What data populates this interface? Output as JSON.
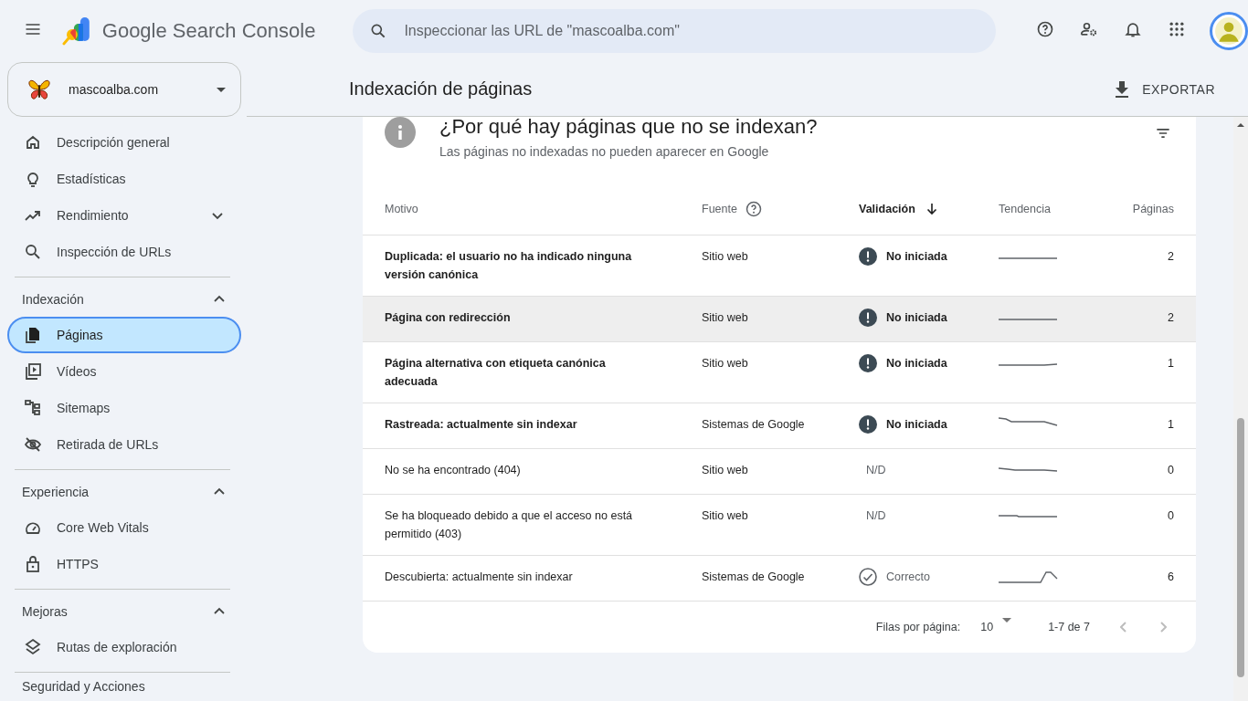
{
  "header": {
    "product_name": "Google Search Console",
    "search": {
      "placeholder": "Inspeccionar las URL de \"mascoalba.com\""
    }
  },
  "property": {
    "name": "mascoalba.com"
  },
  "sidebar": {
    "sections": [
      {
        "items": [
          {
            "label": "Descripción general",
            "selected": false
          },
          {
            "label": "Estadísticas",
            "selected": false
          },
          {
            "label": "Rendimiento",
            "selected": false,
            "expanded": false
          },
          {
            "label": "Inspección de URLs",
            "selected": false
          }
        ]
      },
      {
        "title": "Indexación",
        "expanded": true,
        "items": [
          {
            "label": "Páginas",
            "selected": true
          },
          {
            "label": "Vídeos",
            "selected": false
          },
          {
            "label": "Sitemaps",
            "selected": false
          },
          {
            "label": "Retirada de URLs",
            "selected": false
          }
        ]
      },
      {
        "title": "Experiencia",
        "expanded": true,
        "items": [
          {
            "label": "Core Web Vitals",
            "selected": false
          },
          {
            "label": "HTTPS",
            "selected": false
          }
        ]
      },
      {
        "title": "Mejoras",
        "expanded": true,
        "items": [
          {
            "label": "Rutas de exploración",
            "selected": false
          }
        ]
      },
      {
        "title": "Seguridad y Acciones"
      }
    ]
  },
  "page": {
    "title": "Indexación de páginas",
    "export_button": "EXPORTAR"
  },
  "card": {
    "title": "¿Por qué hay páginas que no se indexan?",
    "subtitle": "Las páginas no indexadas no pueden aparecer en Google",
    "table": {
      "columns": [
        {
          "label": "Motivo",
          "help": false,
          "sorted": false
        },
        {
          "label": "Fuente",
          "help": true,
          "sorted": false
        },
        {
          "label": "Validación",
          "help": false,
          "sorted": true
        },
        {
          "label": "Tendencia",
          "help": false,
          "sorted": false
        },
        {
          "label": "Páginas",
          "help": false,
          "sorted": false
        }
      ],
      "rows": [
        {
          "reason": "Duplicada: el usuario no ha indicado ninguna versión canónica",
          "source": "Sitio web",
          "validation": {
            "kind": "not_started",
            "label": "No iniciada"
          },
          "pages": "2",
          "highlighted": false
        },
        {
          "reason": "Página con redirección",
          "source": "Sitio web",
          "validation": {
            "kind": "not_started",
            "label": "No iniciada"
          },
          "pages": "2",
          "highlighted": true
        },
        {
          "reason": "Página alternativa con etiqueta canónica adecuada",
          "source": "Sitio web",
          "validation": {
            "kind": "not_started",
            "label": "No iniciada"
          },
          "pages": "1",
          "highlighted": false
        },
        {
          "reason": "Rastreada: actualmente sin indexar",
          "source": "Sistemas de Google",
          "validation": {
            "kind": "not_started",
            "label": "No iniciada"
          },
          "pages": "1",
          "highlighted": false
        },
        {
          "reason": "No se ha encontrado (404)",
          "source": "Sitio web",
          "validation": {
            "kind": "na",
            "label": "N/D"
          },
          "pages": "0",
          "highlighted": false
        },
        {
          "reason": "Se ha bloqueado debido a que el acceso no está permitido (403)",
          "source": "Sitio web",
          "validation": {
            "kind": "na",
            "label": "N/D"
          },
          "pages": "0",
          "highlighted": false
        },
        {
          "reason": "Descubierta: actualmente sin indexar",
          "source": "Sistemas de Google",
          "validation": {
            "kind": "passed",
            "label": "Correcto"
          },
          "pages": "6",
          "highlighted": false
        }
      ]
    },
    "pagination": {
      "rows_per_page_label": "Filas por página:",
      "rows_per_page": "10",
      "range": "1-7 de 7"
    }
  }
}
